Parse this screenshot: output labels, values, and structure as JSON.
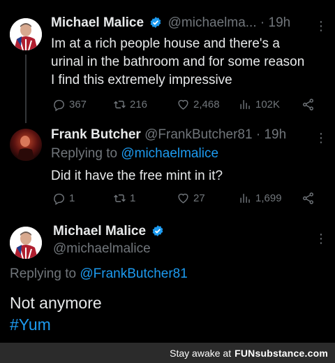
{
  "tweets": [
    {
      "name": "Michael Malice",
      "handle": "@michaelma...",
      "time": "· 19h",
      "text": "Im at a rich people house and there's a urinal in the bathroom and for some reason I find this extremely impressive",
      "stats": {
        "replies": "367",
        "retweets": "216",
        "likes": "2,468",
        "views": "102K"
      }
    },
    {
      "name": "Frank Butcher",
      "handle": "@FrankButcher81",
      "time": "· 19h",
      "replying_prefix": "Replying to",
      "replying_to": "@michaelmalice",
      "text": "Did it have the free mint in it?",
      "stats": {
        "replies": "1",
        "retweets": "1",
        "likes": "27",
        "views": "1,699"
      }
    },
    {
      "name": "Michael Malice",
      "handle": "@michaelmalice",
      "replying_prefix": "Replying to",
      "replying_to": "@FrankButcher81",
      "text": "Not anymore",
      "hashtag": "#Yum"
    }
  ],
  "footer": {
    "prefix": "Stay awake at",
    "brand": "FUNsubstance.com"
  },
  "colors": {
    "background": "#000000",
    "text": "#e7e9ea",
    "muted": "#71767b",
    "link": "#1d9bf0",
    "footer": "#2b2b2b"
  }
}
